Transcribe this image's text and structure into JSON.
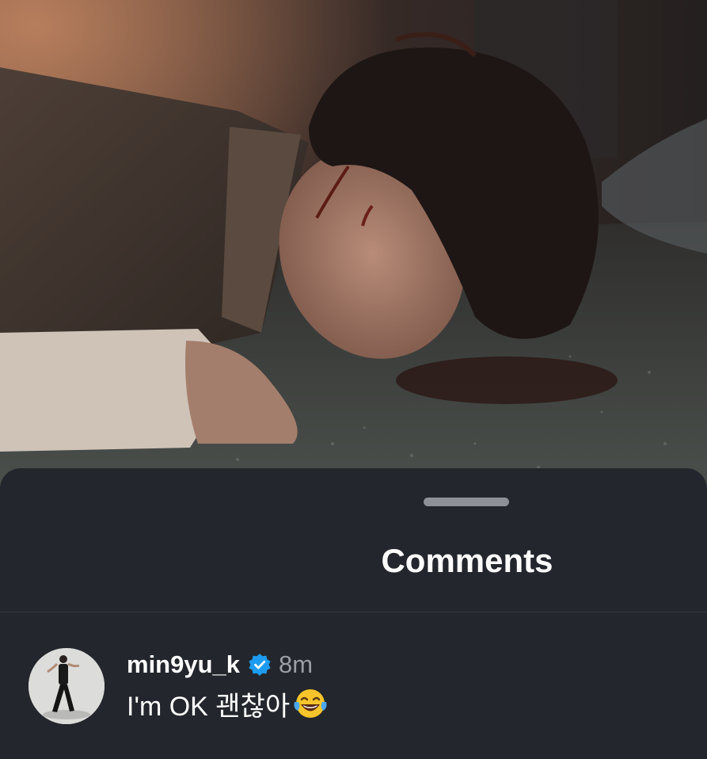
{
  "post": {
    "image_description_icon": "photo"
  },
  "comments_sheet": {
    "title": "Comments",
    "comments": [
      {
        "username": "min9yu_k",
        "verified": true,
        "time": "8m",
        "text": "I'm OK 괜찮아",
        "emoji": "face-with-tears-of-joy"
      }
    ]
  },
  "colors": {
    "sheet_background": "#23262c",
    "verified_badge": "#1d9bf0",
    "timestamp": "#9a9ea5"
  }
}
